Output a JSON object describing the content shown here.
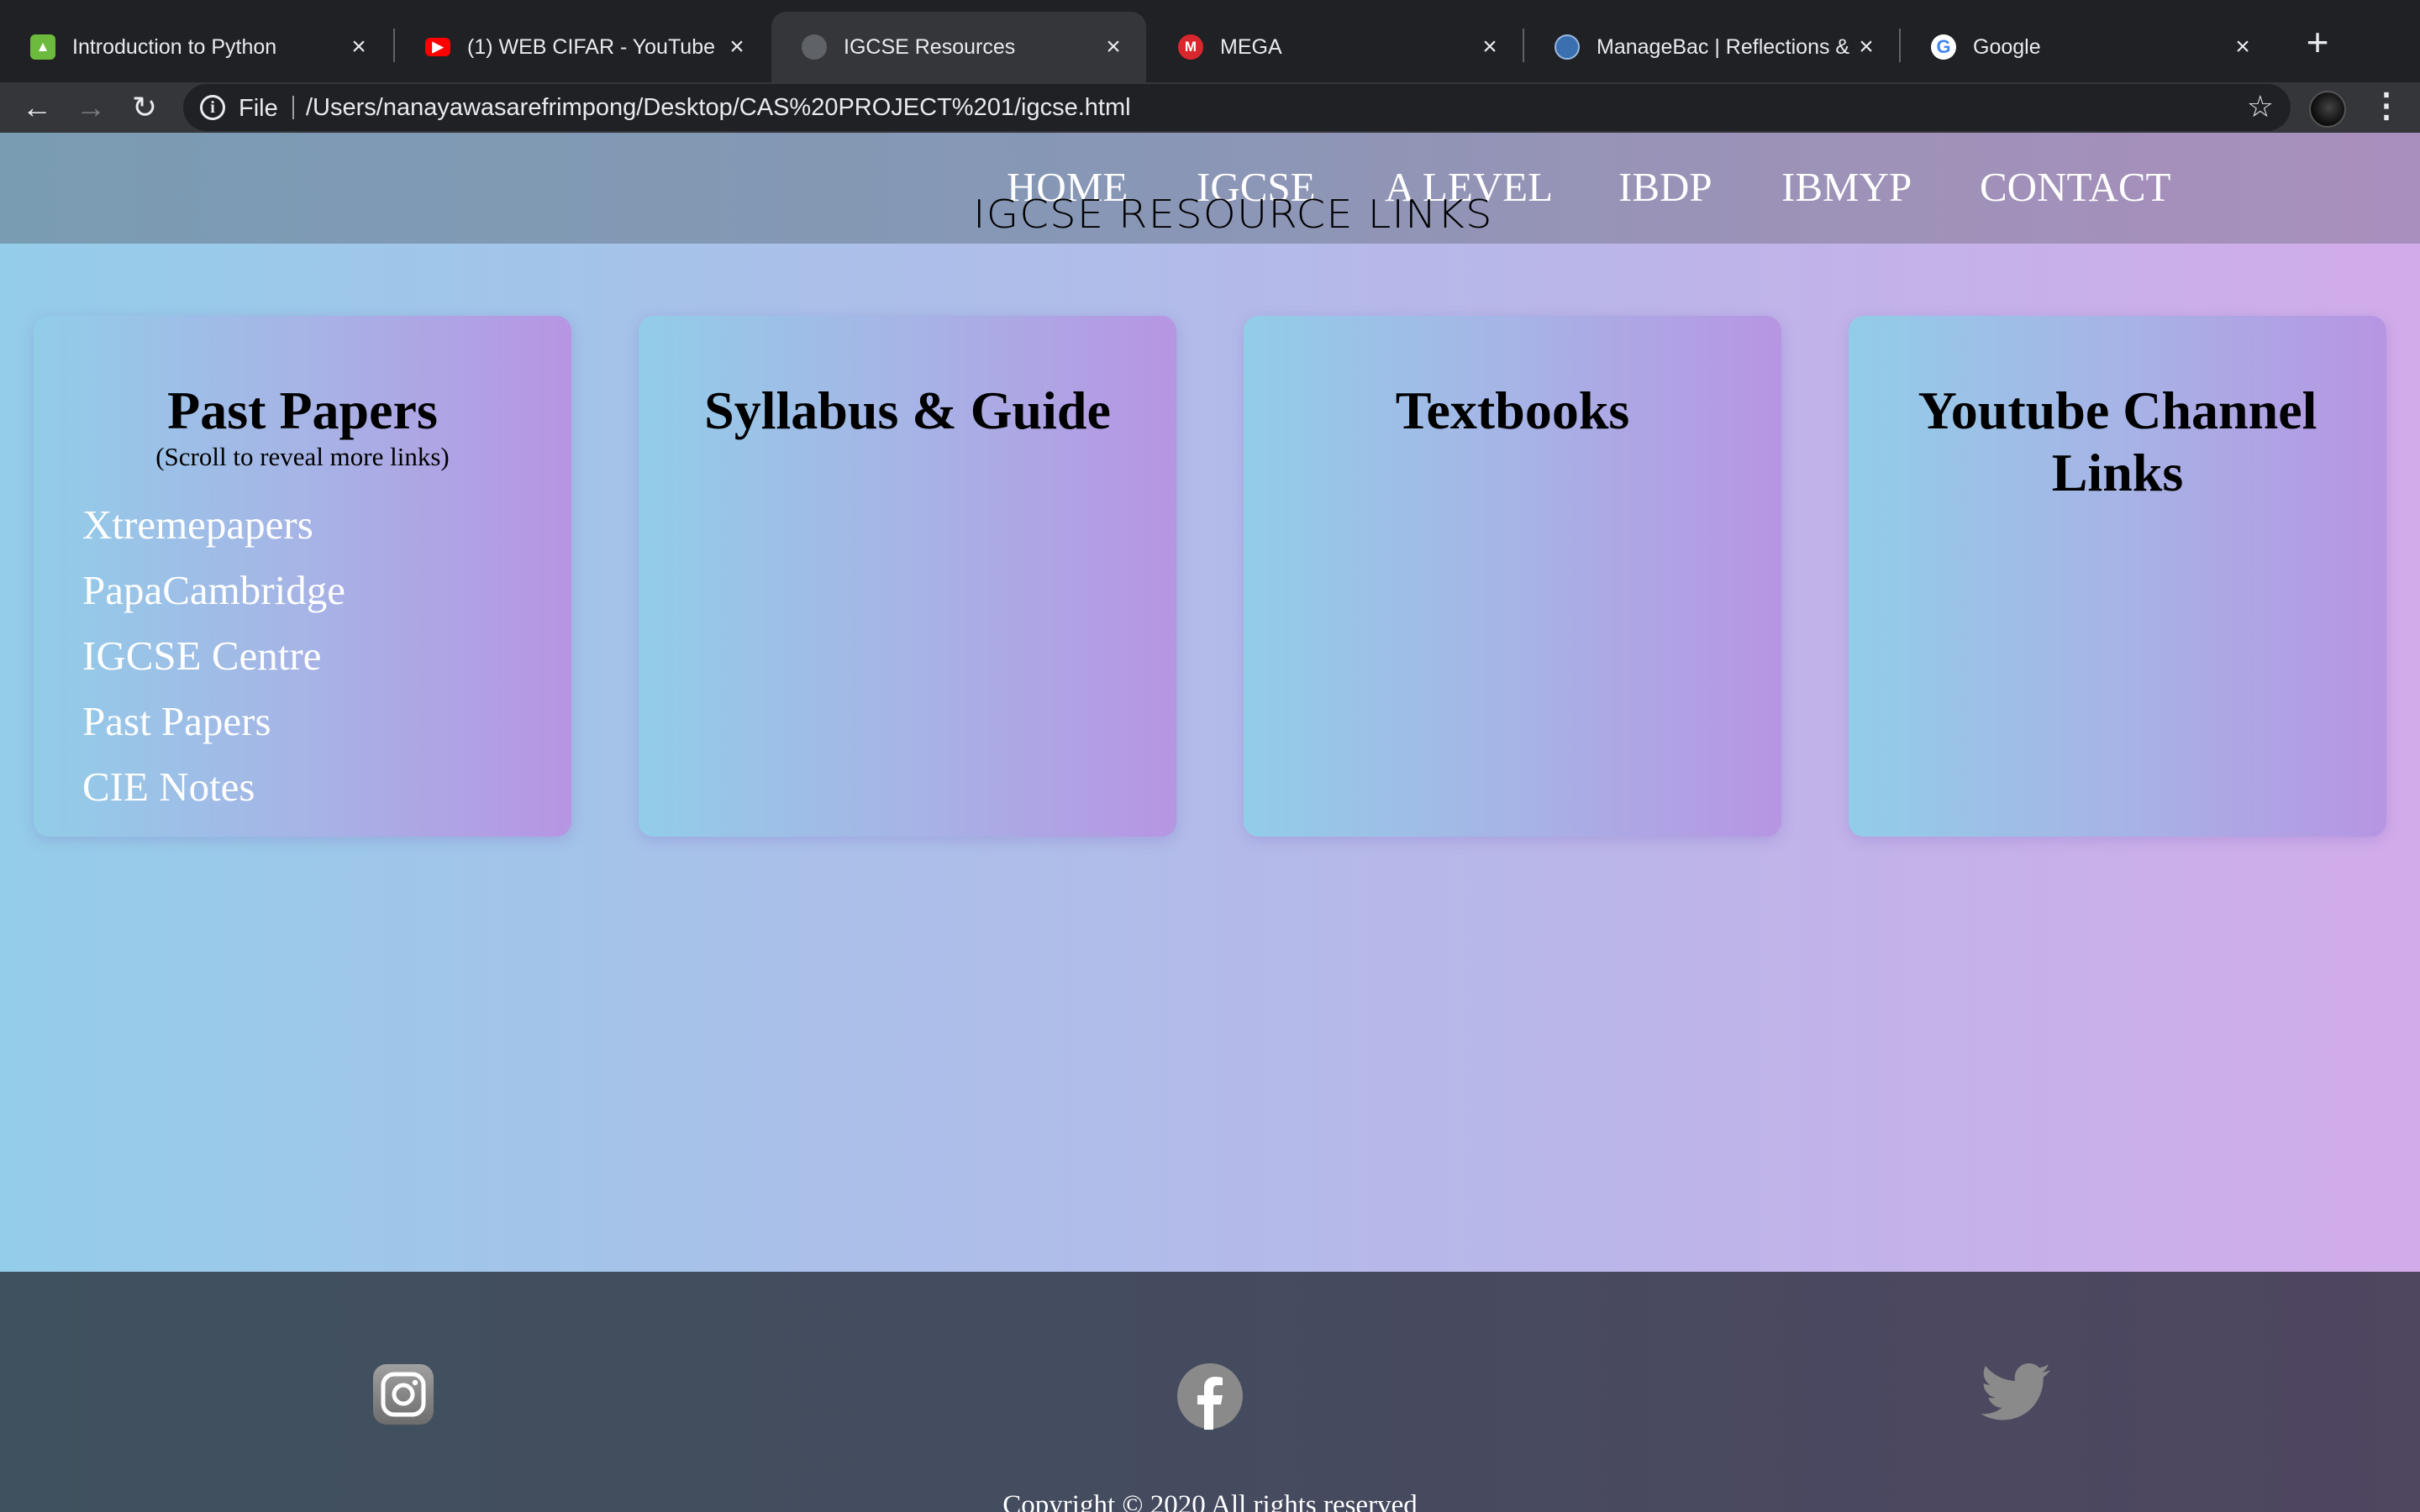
{
  "browser": {
    "tabs": [
      {
        "title": "Introduction to Python",
        "icon": "python-course-icon",
        "active": false
      },
      {
        "title": "(1) WEB CIFAR - YouTube",
        "icon": "youtube-icon",
        "active": false
      },
      {
        "title": "IGCSE Resources",
        "icon": "globe-icon",
        "active": true
      },
      {
        "title": "MEGA",
        "icon": "mega-icon",
        "active": false
      },
      {
        "title": "ManageBac | Reflections & E",
        "icon": "managebac-icon",
        "active": false
      },
      {
        "title": "Google",
        "icon": "google-icon",
        "active": false
      }
    ],
    "address": {
      "scheme_label": "File",
      "url": "/Users/nanayawasarefrimpong/Desktop/CAS%20PROJECT%201/igcse.html"
    }
  },
  "site": {
    "nav": [
      "HOME",
      "IGCSE",
      "A LEVEL",
      "IBDP",
      "IBMYP",
      "CONTACT"
    ],
    "page_title": "IGCSE RESOURCE LINKS",
    "cards": [
      {
        "title": "Past Papers",
        "subtitle": "(Scroll to reveal more links)",
        "links": [
          "Xtremepapers",
          "PapaCambridge",
          "IGCSE Centre",
          "Past Papers",
          "CIE Notes"
        ]
      },
      {
        "title": "Syllabus & Guide",
        "subtitle": "",
        "links": []
      },
      {
        "title": "Textbooks",
        "subtitle": "",
        "links": []
      },
      {
        "title": "Youtube Channel Links",
        "subtitle": "",
        "links": []
      }
    ],
    "footer": {
      "social": [
        "instagram-icon",
        "facebook-icon",
        "twitter-icon"
      ],
      "copyright": "Copyright © 2020 All rights reserved"
    }
  },
  "colors": {
    "chrome_dark": "#202124",
    "chrome_toolbar": "#35363a",
    "page_gradient_start": "#94cde9",
    "page_gradient_end": "#d2acea",
    "footer": "#454b5f"
  }
}
